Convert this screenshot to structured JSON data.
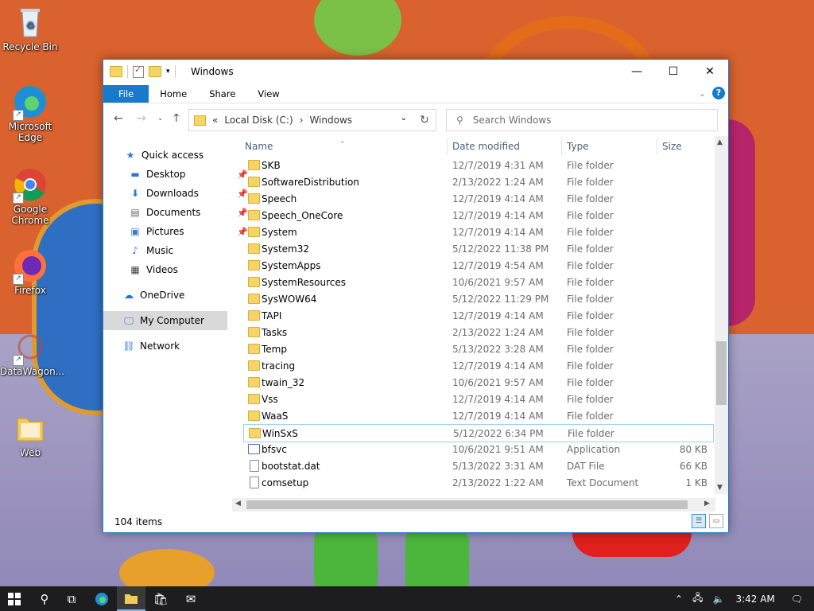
{
  "desktop": {
    "icons": [
      {
        "label": "Recycle Bin"
      },
      {
        "label": "Microsoft Edge"
      },
      {
        "label": "Google Chrome"
      },
      {
        "label": "Firefox"
      },
      {
        "label": "DataWagon..."
      },
      {
        "label": "Web"
      }
    ]
  },
  "window": {
    "title": "Windows",
    "controls": {
      "minimize": "—",
      "maximize": "☐",
      "close": "✕"
    },
    "ribbon_tabs": [
      "File",
      "Home",
      "Share",
      "View"
    ],
    "address": {
      "segments": [
        "«",
        "Local Disk (C:)",
        "›",
        "Windows"
      ]
    },
    "search_placeholder": "Search Windows",
    "nav": {
      "items": [
        {
          "label": "Quick access",
          "icon": "star-icon"
        },
        {
          "label": "Desktop",
          "icon": "desktop-icon",
          "pinned": true
        },
        {
          "label": "Downloads",
          "icon": "download-icon",
          "pinned": true
        },
        {
          "label": "Documents",
          "icon": "document-icon",
          "pinned": true
        },
        {
          "label": "Pictures",
          "icon": "pictures-icon",
          "pinned": true
        },
        {
          "label": "Music",
          "icon": "music-icon"
        },
        {
          "label": "Videos",
          "icon": "videos-icon"
        },
        {
          "label": "OneDrive",
          "icon": "cloud-icon"
        },
        {
          "label": "My Computer",
          "icon": "computer-icon",
          "selected": true
        },
        {
          "label": "Network",
          "icon": "network-icon"
        }
      ]
    },
    "columns": [
      "Name",
      "Date modified",
      "Type",
      "Size"
    ],
    "files": [
      {
        "name": "SKB",
        "date": "12/7/2019 4:31 AM",
        "type": "File folder",
        "size": ""
      },
      {
        "name": "SoftwareDistribution",
        "date": "2/13/2022 1:24 AM",
        "type": "File folder",
        "size": ""
      },
      {
        "name": "Speech",
        "date": "12/7/2019 4:14 AM",
        "type": "File folder",
        "size": ""
      },
      {
        "name": "Speech_OneCore",
        "date": "12/7/2019 4:14 AM",
        "type": "File folder",
        "size": ""
      },
      {
        "name": "System",
        "date": "12/7/2019 4:14 AM",
        "type": "File folder",
        "size": ""
      },
      {
        "name": "System32",
        "date": "5/12/2022 11:38 PM",
        "type": "File folder",
        "size": ""
      },
      {
        "name": "SystemApps",
        "date": "12/7/2019 4:54 AM",
        "type": "File folder",
        "size": ""
      },
      {
        "name": "SystemResources",
        "date": "10/6/2021 9:57 AM",
        "type": "File folder",
        "size": ""
      },
      {
        "name": "SysWOW64",
        "date": "5/12/2022 11:29 PM",
        "type": "File folder",
        "size": ""
      },
      {
        "name": "TAPI",
        "date": "12/7/2019 4:14 AM",
        "type": "File folder",
        "size": ""
      },
      {
        "name": "Tasks",
        "date": "2/13/2022 1:24 AM",
        "type": "File folder",
        "size": ""
      },
      {
        "name": "Temp",
        "date": "5/13/2022 3:28 AM",
        "type": "File folder",
        "size": ""
      },
      {
        "name": "tracing",
        "date": "12/7/2019 4:14 AM",
        "type": "File folder",
        "size": ""
      },
      {
        "name": "twain_32",
        "date": "10/6/2021 9:57 AM",
        "type": "File folder",
        "size": ""
      },
      {
        "name": "Vss",
        "date": "12/7/2019 4:14 AM",
        "type": "File folder",
        "size": ""
      },
      {
        "name": "WaaS",
        "date": "12/7/2019 4:14 AM",
        "type": "File folder",
        "size": ""
      },
      {
        "name": "WinSxS",
        "date": "5/12/2022 6:34 PM",
        "type": "File folder",
        "size": "",
        "selected": true
      },
      {
        "name": "bfsvc",
        "date": "10/6/2021 9:51 AM",
        "type": "Application",
        "size": "80 KB"
      },
      {
        "name": "bootstat.dat",
        "date": "5/13/2022 3:31 AM",
        "type": "DAT File",
        "size": "66 KB"
      },
      {
        "name": "comsetup",
        "date": "2/13/2022 1:22 AM",
        "type": "Text Document",
        "size": "1 KB"
      }
    ],
    "status": "104 items"
  },
  "taskbar": {
    "clock": "3:42 AM"
  }
}
